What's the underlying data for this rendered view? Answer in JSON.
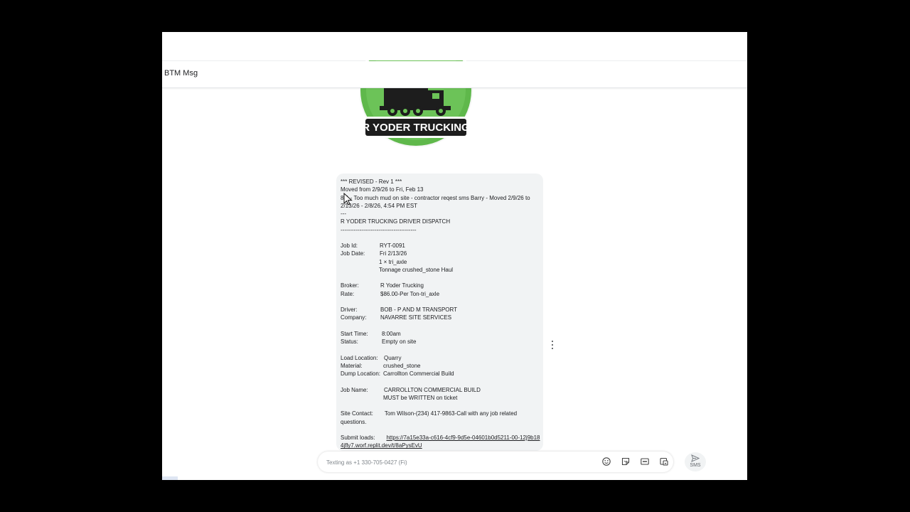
{
  "window": {
    "title": "BTM Msg"
  },
  "logo": {
    "text": "R YODER TRUCKING"
  },
  "message": {
    "lines": [
      "*** REVISED - Rev 1 ***",
      "Moved from 2/9/26 to Fri, Feb 13",
      "8/A - Too much mud on site - contractor reqest sms Barry - Moved 2/9/26 to 2/13/26 - 2/8/26, 4:54 PM EST",
      "---",
      "R YODER TRUCKING DRIVER DISPATCH",
      "----------------------------------------"
    ],
    "rows": [
      {
        "label": "Job Id:",
        "value": "RYT-0091",
        "col": 55
      },
      {
        "label": "Job Date:",
        "value": "Fri 2/13/26",
        "col": 55
      },
      {
        "label": "",
        "value": "1 × tri_axle",
        "col": 54
      },
      {
        "label": "",
        "value": "Tonnage crushed_stone Haul",
        "col": 54
      },
      {
        "blank": true
      },
      {
        "label": "Broker:",
        "value": "R Yoder Trucking",
        "col": 56
      },
      {
        "label": "Rate:",
        "value": "$86.00-Per Ton-tri_axle",
        "col": 56
      },
      {
        "blank": true
      },
      {
        "label": "Driver:",
        "value": "BOB - P AND M TRANSPORT",
        "col": 56
      },
      {
        "label": "Company:",
        "value": "NAVARRE SITE SERVICES",
        "col": 56
      },
      {
        "blank": true
      },
      {
        "label": "Start Time:",
        "value": "8:00am",
        "col": 58
      },
      {
        "label": "Status:",
        "value": "Empty on site",
        "col": 58
      },
      {
        "blank": true
      },
      {
        "label": "Load Location:",
        "value": "Quarry",
        "col": 61
      },
      {
        "label": "Material:",
        "value": "crushed_stone",
        "col": 60
      },
      {
        "label": "Dump Location:",
        "value": "Carrollton Commercial Build",
        "col": 60
      },
      {
        "blank": true
      },
      {
        "label": "Job Name:",
        "value": "CARROLLTON COMMERCIAL BUILD",
        "col": 61
      },
      {
        "label": "",
        "value": "MUST be WRITTEN on ticket",
        "col": 60
      },
      {
        "blank": true
      }
    ],
    "site_contact_label": "Site Contact:",
    "site_contact_value": "Tom Wilson-(234) 417-9863-Call with any job related questions.",
    "submit_label": "Submit loads:",
    "submit_link": "https://7a15e33a-c616-4cf9-9d5e-04601b0d5211-00-12j9b184jfly7.worf.replit.dev/t/8aPysEvU"
  },
  "compose": {
    "placeholder": "Texting as +1 330-705-0427 (Fi)",
    "send_label": "SMS",
    "icons": [
      "emoji-icon",
      "sticker-icon",
      "gif-icon",
      "attach-media-icon"
    ]
  }
}
